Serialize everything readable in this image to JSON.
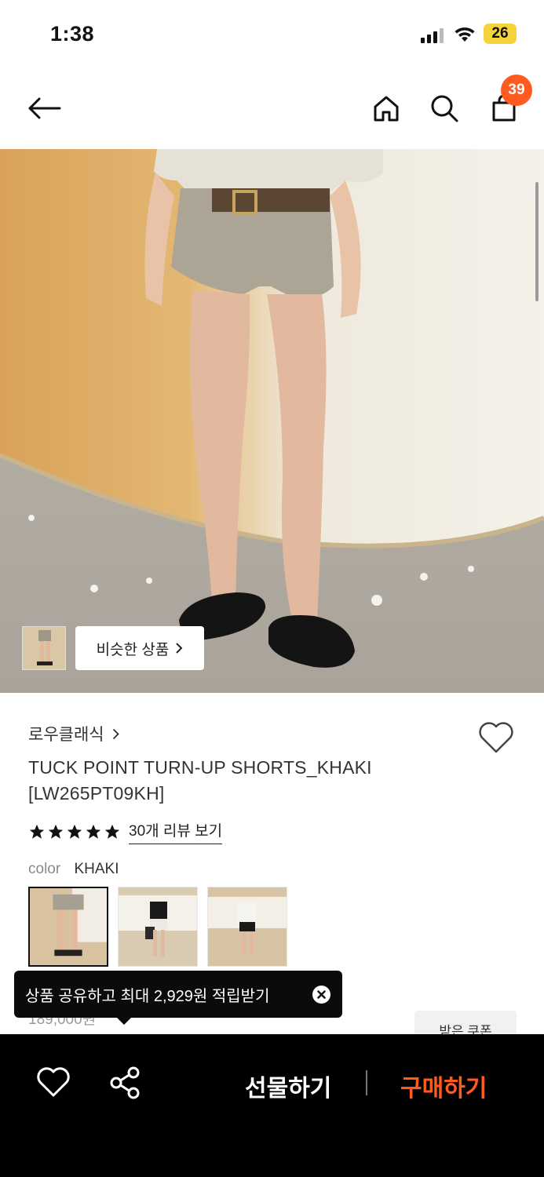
{
  "status_bar": {
    "time": "1:38",
    "battery": "26"
  },
  "header": {
    "cart_count": "39"
  },
  "hero": {
    "similar_label": "비슷한 상품"
  },
  "product": {
    "brand": "로우클래식",
    "title_line1": "TUCK POINT TURN-UP SHORTS_KHAKI",
    "title_line2": "[LW265PT09KH]",
    "rating": 5,
    "review_link": "30개 리뷰 보기",
    "color_label": "color",
    "color_value": "KHAKI",
    "variants": [
      "khaki",
      "white",
      "black"
    ]
  },
  "tooltip": {
    "text": "상품 공유하고 최대 2,929원 적립받기"
  },
  "partial": {
    "price": "189,000원",
    "coupon": "받은 쿠폰"
  },
  "bottom_bar": {
    "gift_label": "선물하기",
    "buy_label": "구매하기"
  },
  "colors": {
    "accent": "#ff5a1f",
    "battery": "#f5d33b",
    "bar": "#000000"
  }
}
